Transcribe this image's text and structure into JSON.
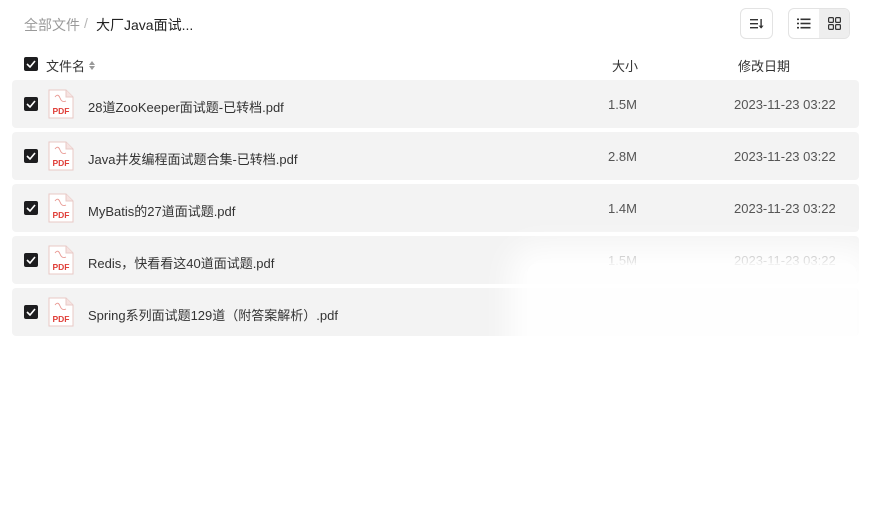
{
  "breadcrumb": {
    "root": "全部文件",
    "separator": "/",
    "current": "大厂Java面试..."
  },
  "toolbar": {
    "sort_icon": "sort-icon",
    "list_view_icon": "list-view-icon",
    "grid_view_icon": "grid-view-icon",
    "active_view": "grid"
  },
  "table": {
    "headers": {
      "name": "文件名",
      "size": "大小",
      "modified": "修改日期"
    },
    "files": [
      {
        "icon_label": "PDF",
        "name": "28道ZooKeeper面试题-已转档.pdf",
        "size": "1.5M",
        "modified": "2023-11-23 03:22"
      },
      {
        "icon_label": "PDF",
        "name": "Java并发编程面试题合集-已转档.pdf",
        "size": "2.8M",
        "modified": "2023-11-23 03:22"
      },
      {
        "icon_label": "PDF",
        "name": "MyBatis的27道面试题.pdf",
        "size": "1.4M",
        "modified": "2023-11-23 03:22"
      },
      {
        "icon_label": "PDF",
        "name": "Redis，快看看这40道面试题.pdf",
        "size": "1.5M",
        "modified": "2023-11-23 03:22"
      },
      {
        "icon_label": "PDF",
        "name": "Spring系列面试题129道（附答案解析）.pdf",
        "size": "",
        "modified": ""
      }
    ]
  },
  "colors": {
    "row_bg": "#f3f3f3",
    "checkbox": "#1d1d1f",
    "pdf_red": "#e0403a"
  }
}
